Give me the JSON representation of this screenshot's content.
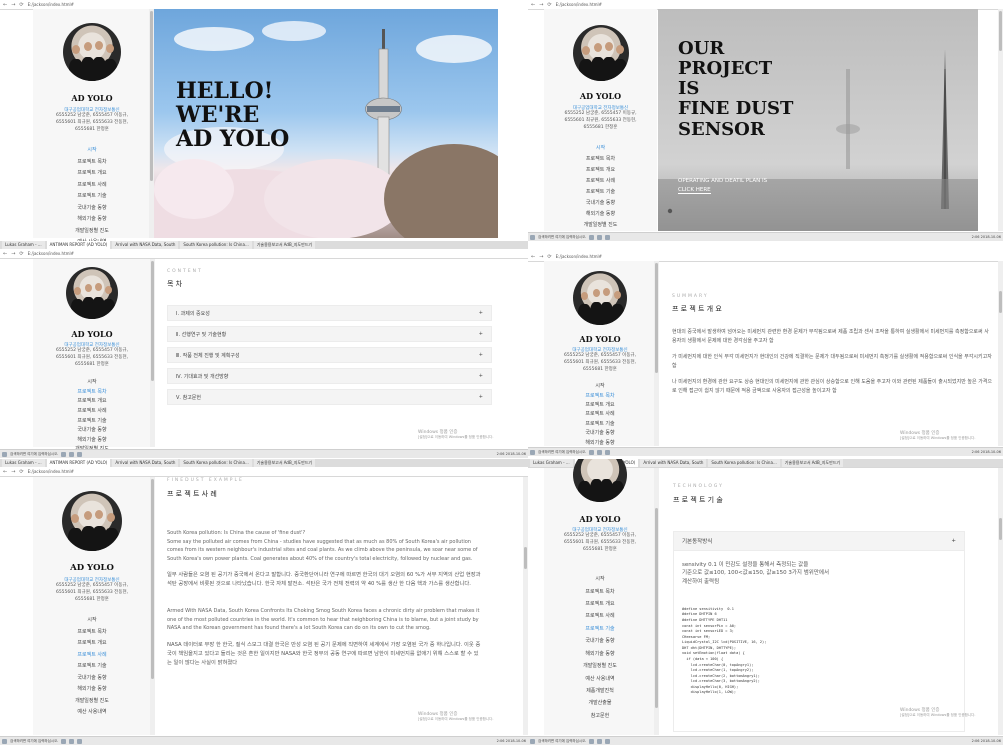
{
  "browser": {
    "tabs": [
      "Lukas Graham - ...",
      "ANTIMAN REPORT (AD YOLO)",
      "Arrival with NASA Data, South",
      "South Korea pollution: Is China...",
      "기술용용보고서 AdB_지도만드기",
      "기술용용보고서 AdB_지도만드기"
    ],
    "address": "file:///E:/jackson/index.html#",
    "address_short": "E:/jackson/index.html#"
  },
  "taskbar": {
    "search_placeholder": "검색하려면 여기에 입력하십시오.",
    "time": "2:06",
    "date": "2018-10-06"
  },
  "sidebar": {
    "brand": "AD YOLO",
    "affiliation": "대구공업대학교 전자정보통신",
    "members": [
      "6555252 남궁준, 6555457 이동규,",
      "6555601 최규원, 6555633 전동현,",
      "6555681 한정훈"
    ],
    "menu": [
      "시작",
      "프로젝트 목차",
      "프로젝트 개요",
      "프로젝트 사례",
      "프로젝트 기술",
      "국내기술 동향",
      "해외기술 동향",
      "개발일정별 진도",
      "예산 사용내역",
      "제품개발진척",
      "개발산출물",
      "참고문헌"
    ]
  },
  "hero1": {
    "lines": [
      "HELLO!",
      "WE'RE",
      "AD YOLO"
    ]
  },
  "hero2": {
    "lines": [
      "OUR",
      "PROJECT",
      "IS",
      "FINE DUST",
      "SENSOR"
    ],
    "subtitle": "OPERATING AND DEATIL PLAN IS",
    "link": "CLICK HERE"
  },
  "contents": {
    "label": "CONTENT",
    "title": "목 차",
    "items": [
      "Ⅰ. 과제의 중요성",
      "Ⅱ. 선행연구 및 기술현황",
      "Ⅲ. 작품 전체 진행 및 계획구성",
      "Ⅳ. 기대효과 및 개선방향",
      "Ⅴ. 참고문헌"
    ],
    "expand": "+"
  },
  "summary": {
    "label": "SUMMARY",
    "title": "프 로 젝 트  개 요",
    "paragraphs": [
      "현대의 중국에서 발생하여 넘어오는 미세먼지 관련한 환경 문제가 부각됨으로써 제품 조립과 센서 조작을 통하여 실생활에서 미세먼지를 측정함으로써 사용자의 생활에서 문제에 대한 경각심을 주고자 함",
      "가 미세먼지에 대한 인식 부각 미세먼지가 현대인의 건강에 직결하는 문제가 대두됨으로써 미세먼지 측정기를 실생활에 적용함으로써 인식을 부각시키고자 함",
      "나 미세먼지의 환경에 관한 요구도 상승 현대인의 미세먼지에 관한 관심이 상승함으로 인해 도움을 주고자 이와 관련된 제품들이 출시되었지만 높은 가격으로 인해 접근이 쉽지 않기 때문에 적용 금액으로 사용자의 접근성을 높이고자 함"
    ]
  },
  "example": {
    "label": "FINEDUST EXAMPLE",
    "title": "프 로 젝 트  사 례",
    "en1_title": "South Korea pollution: Is China the cause of 'fine dust'?",
    "en1": "Some say the polluted air comes from China - studies have suggested that as much as 80% of South Korea's air pollution comes from its western neighbour's industrial sites and coal plants. As we climb above the peninsula, we soar near some of South Korea's own power plants. Coal generates about 40% of the country's total electricity, followed by nuclear and gas.",
    "ko1": "일부 사람들은 오염 된 공기가 중국에서 온다고 말합니다. 중국환단어니라 연구에 따르면 한국의 대기 오염의 60 %가 서부 지역의 산업 현장과 석탄 공장에서 비롯된 것으로 나타났습니다. 한국 자체 발전소. 석탄은 국가 전체 전력의 약 40 %를 생산 한 다음 핵과 가스를 생산합니다.",
    "en2": "Armed With NASA Data, South Korea Confronts Its Choking Smog South Korea faces a chronic dirty air problem that makes it one of the most polluted countries in the world. It's common to hear that neighboring China is to blame, but a joint study by NASA and the Korean government has found there's a lot South Korea can do on its own to cut the smog.",
    "ko2": "NASA 데이터로 무장 한 한국, 질식 스모그 대결 한국은 만성 오염 된 공기 문제에 직면하여 세계에서 가장 오염된 국가 중 하나입니다. 이웃 중국이 책임을지고 있다고 들리는 것은 흔한 일이지만 NASA와 한국 정부의 공동 연구에 따르면 남한이 미세먼지를 없애기 위해 스스로 할 수 있는 일이 많다는 사실이 밝혀졌다"
  },
  "technology": {
    "label": "TECHNOLOGY",
    "title": "프 로 젝 트  기 술",
    "accordion": "기본동작방식",
    "expand": "+",
    "desc": [
      "sensivity 0.1 이 민감도 설정을 통해서 측정되는 값을",
      "기준으로 값≤100, 100<값≤150, 값≥150 3가지 범위만에서",
      "계산하여 출력됨"
    ],
    "code": [
      "#define sensitivity  0.1",
      "",
      "#define DHTPIN 6",
      "#define DHTTYPE DHT11",
      "",
      "const int sensorPin = A0;",
      "const int sensorLED = 3;",
      "",
      "CHeesarve FM;",
      "LiquidCrystal_I2C lcd(POSITIVE, 16, 2);",
      "",
      "DHT dht(DHTPIN, DHTTYPE);",
      "",
      "void setEmotion(float data) {",
      "  if (data < 100) {",
      "    lcd.createChar(0, topAngry1);",
      "    lcd.createChar(1, topAngry2);",
      "    lcd.createChar(2, bottomAngry1);",
      "    lcd.createChar(3, bottomAngry2);",
      "    displayHello(0, HIGH);",
      "    displayHello(1, LOW);"
    ]
  },
  "watermark": {
    "line1": "Windows 정품 인증",
    "line2": "[설정]으로 이동하여 Windows를 정품 인증합니다."
  }
}
